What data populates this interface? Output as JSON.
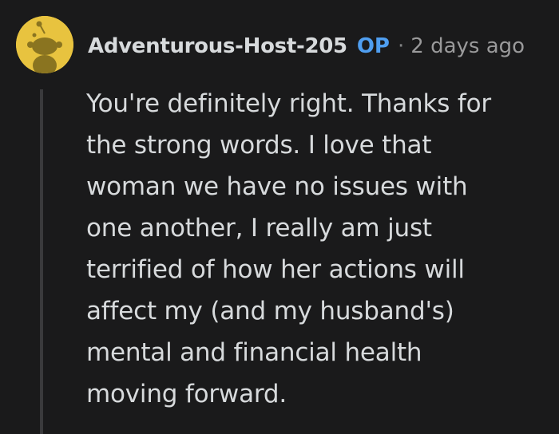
{
  "comment": {
    "author": "Adventurous-Host-205",
    "op_badge": "OP",
    "separator": "·",
    "timestamp": "2 days ago",
    "avatar_icon": "snoo-avatar-icon",
    "avatar_color": "#e8c33f",
    "body_lines": [
      "You're definitely right. Thanks for",
      "the strong words. I love that",
      "woman we have no issues with",
      "one another, I really am just",
      "terrified of how her actions will",
      "affect my (and my husband's)",
      "mental and financial health",
      "moving forward."
    ]
  },
  "colors": {
    "background": "#1a1a1b",
    "text": "#d7dadc",
    "op_badge": "#4f9ef0",
    "meta": "#9a9a9b",
    "thread_line": "#3a3a3c"
  }
}
